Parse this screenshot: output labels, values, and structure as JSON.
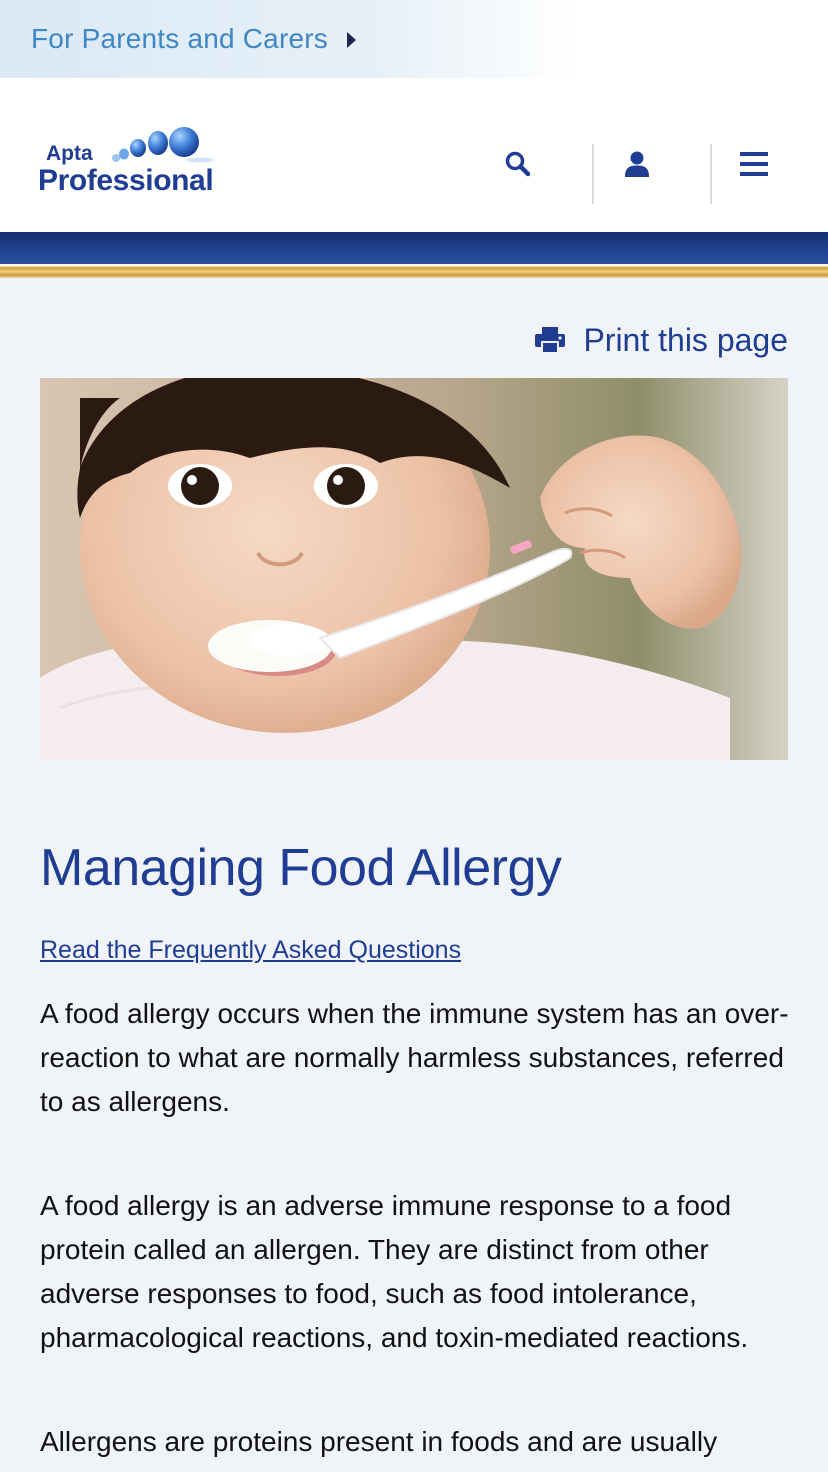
{
  "top_banner": {
    "label": "For Parents and Carers"
  },
  "header": {
    "logo": {
      "line1": "Apta",
      "line2": "Professional"
    },
    "icons": [
      "search-icon",
      "user-icon",
      "menu-icon"
    ]
  },
  "colors": {
    "brand_blue": "#1f3d93",
    "banner_text": "#3f86c4",
    "gold": "#f2cf72",
    "page_bg": "#f0f4f8"
  },
  "print": {
    "label": "Print this page",
    "icon": "printer-icon"
  },
  "hero": {
    "alt": "hero-image"
  },
  "article": {
    "title": "Managing Food Allergy",
    "faq_link": "Read the Frequently Asked Questions",
    "paragraphs": [
      "A food allergy occurs when the immune system has an over-reaction to what are normally harmless substances, referred to as allergens.",
      "A food allergy is an adverse immune response to a food protein called an allergen. They are distinct from other adverse responses to food, such as food intolerance, pharmacological reactions, and toxin-mediated reactions.",
      "Allergens are proteins present in foods and are usually"
    ]
  }
}
